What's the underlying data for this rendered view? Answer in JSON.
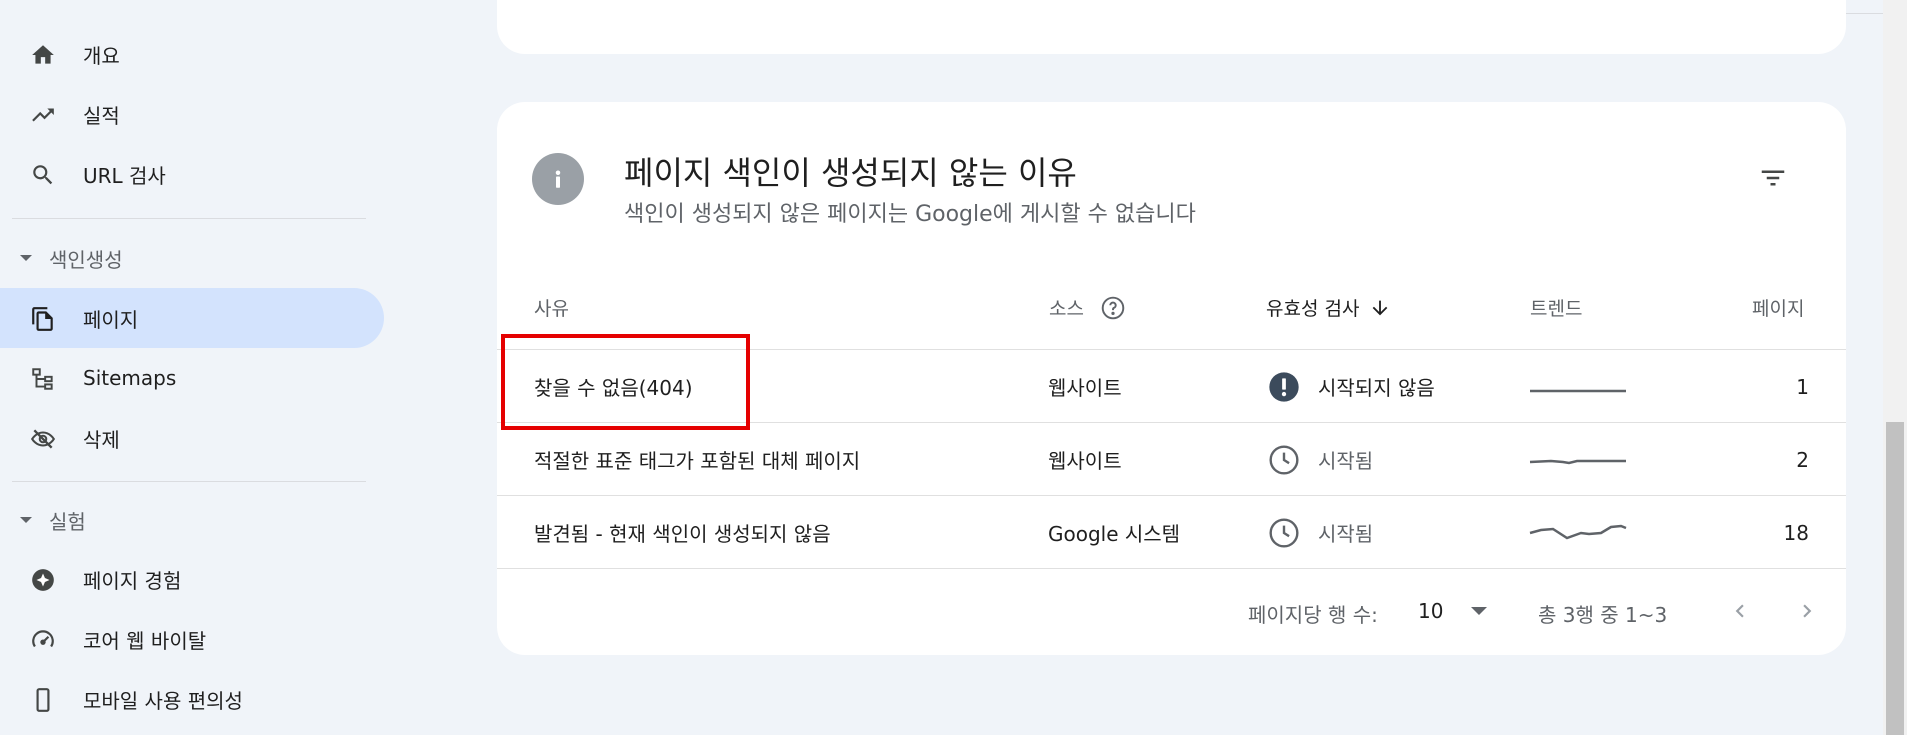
{
  "sidebar": {
    "items": [
      {
        "label": "개요",
        "icon": "home-icon"
      },
      {
        "label": "실적",
        "icon": "trending-up-icon"
      },
      {
        "label": "URL 검사",
        "icon": "search-icon"
      }
    ],
    "section_indexing": {
      "label": "색인생성"
    },
    "indexing_items": [
      {
        "label": "페이지",
        "icon": "pages-icon",
        "active": true
      },
      {
        "label": "Sitemaps",
        "icon": "sitemap-icon"
      },
      {
        "label": "삭제",
        "icon": "eye-off-icon"
      }
    ],
    "section_experience": {
      "label": "실험"
    },
    "experience_items": [
      {
        "label": "페이지 경험",
        "icon": "experience-star-icon"
      },
      {
        "label": "코어 웹 바이탈",
        "icon": "speedometer-icon"
      },
      {
        "label": "모바일 사용 편의성",
        "icon": "phone-icon"
      }
    ]
  },
  "card": {
    "title": "페이지 색인이 생성되지 않는 이유",
    "subtitle": "색인이 생성되지 않은 페이지는 Google에 게시할 수 없습니다",
    "columns": {
      "reason": "사유",
      "source": "소스",
      "validation": "유효성 검사",
      "trend": "트렌드",
      "pages": "페이지"
    },
    "rows": [
      {
        "reason": "찾을 수 없음(404)",
        "source": "웹사이트",
        "validation": "시작되지 않음",
        "validation_icon": "alert-circle-icon",
        "pages": "1"
      },
      {
        "reason": "적절한 표준 태그가 포함된 대체 페이지",
        "source": "웹사이트",
        "validation": "시작됨",
        "validation_icon": "clock-icon",
        "pages": "2"
      },
      {
        "reason": "발견됨 - 현재 색인이 생성되지 않음",
        "source": "Google 시스템",
        "validation": "시작됨",
        "validation_icon": "clock-icon",
        "pages": "18"
      }
    ],
    "footer": {
      "rows_per_page_label": "페이지당 행 수:",
      "rows_per_page_value": "10",
      "range_text": "총 3행 중 1~3"
    }
  },
  "colors": {
    "active_nav_bg": "#d3e3fd",
    "highlight_border": "#e50000",
    "alert_icon": "#3c4b5c",
    "muted_text": "#5f6368"
  }
}
